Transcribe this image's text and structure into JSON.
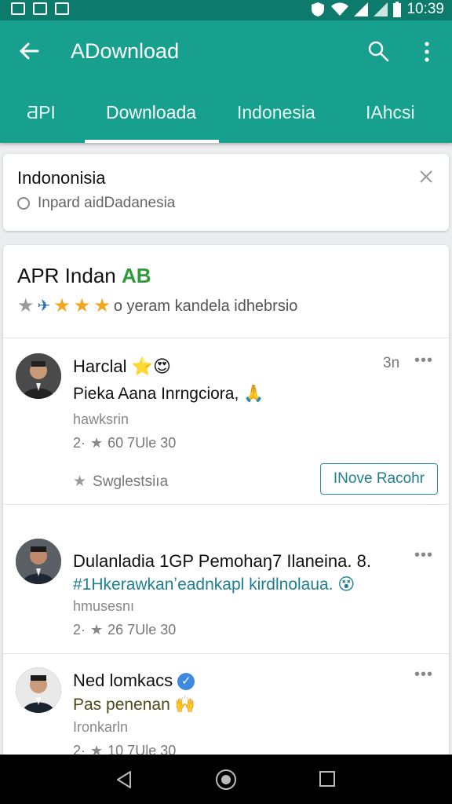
{
  "status_bar": {
    "time": "10:39"
  },
  "app_bar": {
    "title": "ADownload"
  },
  "tabs": [
    {
      "label": "ƋPI"
    },
    {
      "label": "Downloada"
    },
    {
      "label": "Indonesia"
    },
    {
      "label": "IAhcsi"
    }
  ],
  "search_card": {
    "title": "Indononisia",
    "subtitle": "Inpard aidDadanesia"
  },
  "main_card": {
    "title": "APR Indan",
    "title_badge": "AB",
    "rating_text": "o yeram kandela idhebrsio"
  },
  "posts": [
    {
      "name": "Harclal",
      "emoji": "⭐😍",
      "time": "3n",
      "text": "Pieka Aana Inrngciora,",
      "text_emoji": "🙏",
      "handle": "hawksrin",
      "stat_a": "2·",
      "stat_b": "60 7Ule 30",
      "suggest_label": "Swglestsiıa",
      "action_label": "INove Racohr"
    },
    {
      "name": "Dulanladia 1GP Pemohaŋ7 Ilaneina. 8.",
      "text": "#1Hkerawkanʼeadnkapl kirdlnolaua.",
      "text_emoji": "😵",
      "handle": "hmusesnı",
      "stat_a": "2·",
      "stat_b": "26 7Ule 30"
    },
    {
      "name": "Ned lomkacs",
      "text": "Pas penenan",
      "text_emoji": "🙌",
      "handle": "Ironkarln",
      "stat_a": "2·",
      "stat_b": "10 7Ule 30"
    }
  ],
  "colors": {
    "primary": "#16a08d",
    "status_bar": "#0d7b6b",
    "accent_teal": "#1d7f90"
  }
}
